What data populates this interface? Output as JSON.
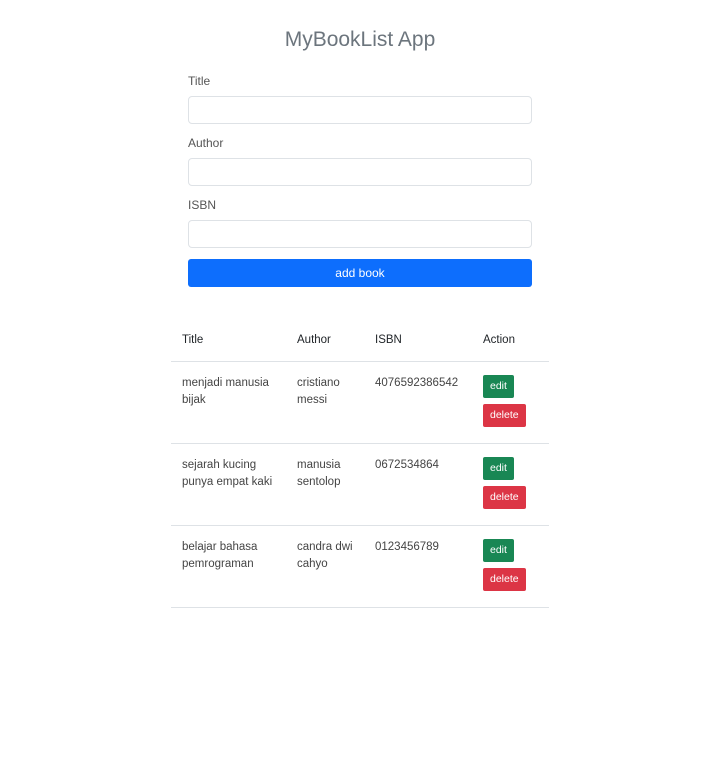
{
  "app": {
    "title": "MyBookList App"
  },
  "form": {
    "title_label": "Title",
    "title_value": "",
    "author_label": "Author",
    "author_value": "",
    "isbn_label": "ISBN",
    "isbn_value": "",
    "submit_label": "add book"
  },
  "table": {
    "headers": {
      "title": "Title",
      "author": "Author",
      "isbn": "ISBN",
      "action": "Action"
    },
    "rows": [
      {
        "title": "menjadi manusia bijak",
        "author": "cristiano messi",
        "isbn": "4076592386542",
        "edit_label": "edit",
        "delete_label": "delete"
      },
      {
        "title": "sejarah kucing punya empat kaki",
        "author": "manusia sentolop",
        "isbn": "0672534864",
        "edit_label": "edit",
        "delete_label": "delete"
      },
      {
        "title": "belajar bahasa pemrograman",
        "author": "candra dwi cahyo",
        "isbn": "0123456789",
        "edit_label": "edit",
        "delete_label": "delete"
      }
    ]
  },
  "colors": {
    "primary": "#0d6efd",
    "success": "#198754",
    "danger": "#dc3545",
    "title_gray": "#6c757d"
  }
}
